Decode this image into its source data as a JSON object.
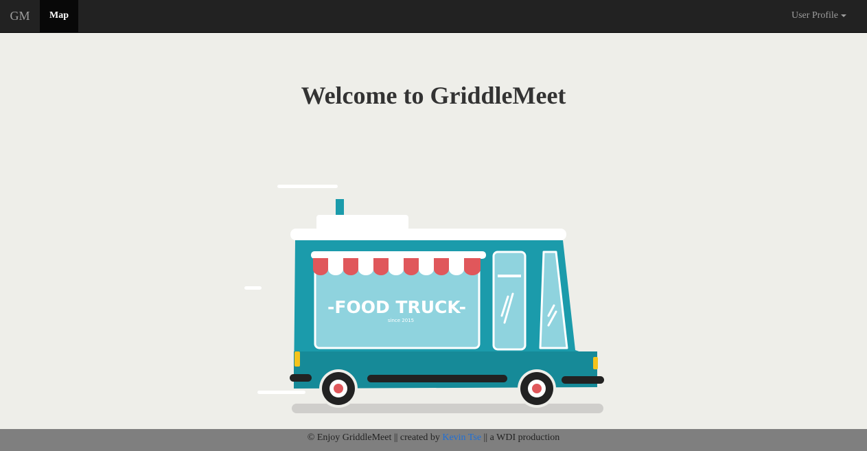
{
  "navbar": {
    "brand": "GM",
    "map_label": "Map",
    "profile_label": "User Profile"
  },
  "main": {
    "title": "Welcome to GriddleMeet",
    "illustration": {
      "sign_text": "-FOOD TRUCK-",
      "since_text": "since 2015"
    }
  },
  "footer": {
    "prefix": "© Enjoy GriddleMeet || created by ",
    "author_link": "Kevin Tse",
    "suffix": " || a WDI production"
  },
  "colors": {
    "navbar_bg": "#222222",
    "active_nav_bg": "#080808",
    "page_bg": "#eeeee9",
    "truck_teal": "#1b9bab",
    "truck_window": "#8fd3de",
    "awning_red": "#e0575b",
    "footer_bg": "#7f7f7f",
    "link_blue": "#1f6fd6"
  }
}
